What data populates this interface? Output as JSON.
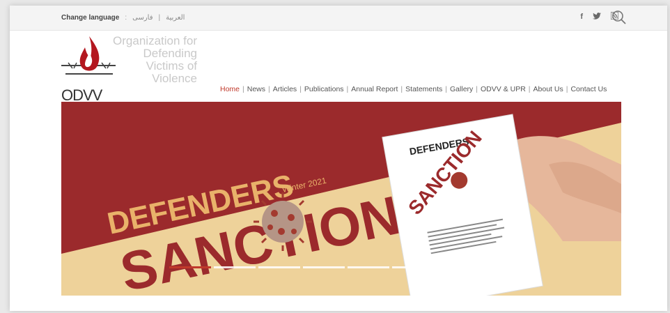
{
  "topbar": {
    "change_language": "Change language",
    "lang_persian": "فارسی",
    "lang_arabic": "العربية",
    "social": [
      "f",
      "t",
      "rss"
    ]
  },
  "logo": {
    "acronym": "ODVV",
    "org_line1": "Organization for",
    "org_line2": "Defending",
    "org_line3": "Victims of",
    "org_line4": "Violence"
  },
  "nav": {
    "items": [
      "Home",
      "News",
      "Articles",
      "Publications",
      "Annual Report",
      "Statements",
      "Gallery",
      "ODVV & UPR",
      "About Us",
      "Contact Us"
    ],
    "active_index": 0
  },
  "banner": {
    "title1": "DEFENDERS",
    "subtitle": "Winter 2021",
    "title2": "SANCTION",
    "magazine_title": "DEFENDERS",
    "magazine_cover": "SANCTION",
    "colors": {
      "maroon": "#9b2a2c",
      "sand": "#eed29a",
      "accent": "#c0392b"
    },
    "slides": 6,
    "active_slide": 0
  }
}
